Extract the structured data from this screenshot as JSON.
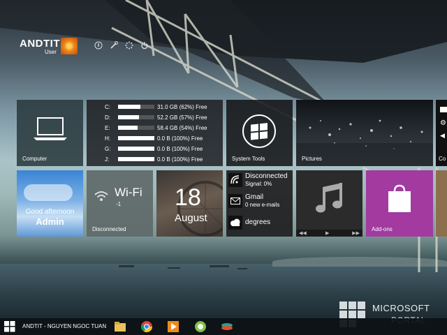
{
  "user": {
    "name": "ANDTIT",
    "role": "User"
  },
  "top_icons": [
    "info-icon",
    "wrench-icon",
    "loading-icon",
    "power-icon"
  ],
  "tiles": {
    "computer": {
      "label": "Computer"
    },
    "drives": [
      {
        "letter": "C:",
        "used_pct": 38,
        "text": "31.0 GB (62%) Free"
      },
      {
        "letter": "D:",
        "used_pct": 43,
        "text": "52.2 GB (57%) Free"
      },
      {
        "letter": "E:",
        "used_pct": 46,
        "text": "58.4 GB (54%) Free"
      },
      {
        "letter": "H:",
        "used_pct": 0,
        "text": "0.0 B (100%) Free"
      },
      {
        "letter": "G:",
        "used_pct": 0,
        "text": "0.0 B (100%) Free"
      },
      {
        "letter": "J:",
        "used_pct": 0,
        "text": "0.0 B (100%) Free"
      }
    ],
    "system_tools": {
      "label": "System Tools"
    },
    "pictures": {
      "label": "Pictures"
    },
    "partial_right": {
      "label": "Co"
    },
    "weather": {
      "greeting": "Good afternoon",
      "name": "Admin"
    },
    "wifi": {
      "title": "Wi-Fi",
      "value": "-1",
      "label": "Disconnected"
    },
    "date": {
      "day": "18",
      "month": "August"
    },
    "status": {
      "network": {
        "main": "Disconnected",
        "sub": "Signal: 0%"
      },
      "mail": {
        "main": "Gmail",
        "sub": "0 new e-mails"
      },
      "weather": {
        "main": "degrees"
      }
    },
    "music": {
      "label": ""
    },
    "addons": {
      "label": "Add-ons"
    }
  },
  "taskbar": {
    "title": "ANDTIT - NGUYEN NGOC TUAN",
    "apps": [
      "folder-icon",
      "chrome-icon",
      "media-player-icon",
      "green-app-icon",
      "colorful-app-icon"
    ]
  },
  "watermark": {
    "line1": "MICROSOFT",
    "line2": "PORTAL"
  },
  "colors": {
    "addons": "#a23aa0",
    "taskbar": "#0c1014"
  }
}
